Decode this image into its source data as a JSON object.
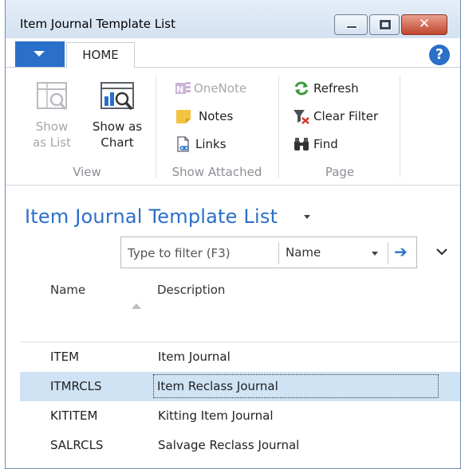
{
  "window": {
    "title": "Item Journal Template List",
    "close_glyph": "✕"
  },
  "ribbon": {
    "app_menu": "app-menu-dropdown",
    "tabs": [
      {
        "label": "HOME"
      }
    ],
    "help": "?",
    "groups": {
      "view": {
        "label": "View",
        "show_as_list": {
          "line1": "Show",
          "line2": "as List"
        },
        "show_as_chart": {
          "line1": "Show as",
          "line2": "Chart"
        }
      },
      "show_attached": {
        "label": "Show Attached",
        "onenote": "OneNote",
        "notes": "Notes",
        "links": "Links"
      },
      "page": {
        "label": "Page",
        "refresh": "Refresh",
        "clear_filter": "Clear Filter",
        "find": "Find"
      }
    }
  },
  "main": {
    "title": "Item Journal Template List",
    "filter": {
      "placeholder": "Type to filter (F3)",
      "field": "Name"
    },
    "columns": {
      "name": "Name",
      "description": "Description"
    },
    "rows": [
      {
        "name": "ITEM",
        "description": "Item Journal"
      },
      {
        "name": "ITMRCLS",
        "description": "Item Reclass Journal"
      },
      {
        "name": "KITITEM",
        "description": "Kitting Item Journal"
      },
      {
        "name": "SALRCLS",
        "description": "Salvage Reclass Journal"
      }
    ],
    "selected_row_index": 1
  },
  "colors": {
    "accent": "#2a6fc9",
    "selected_row": "#cfe3f5",
    "disabled_text": "#a3a8ad"
  }
}
